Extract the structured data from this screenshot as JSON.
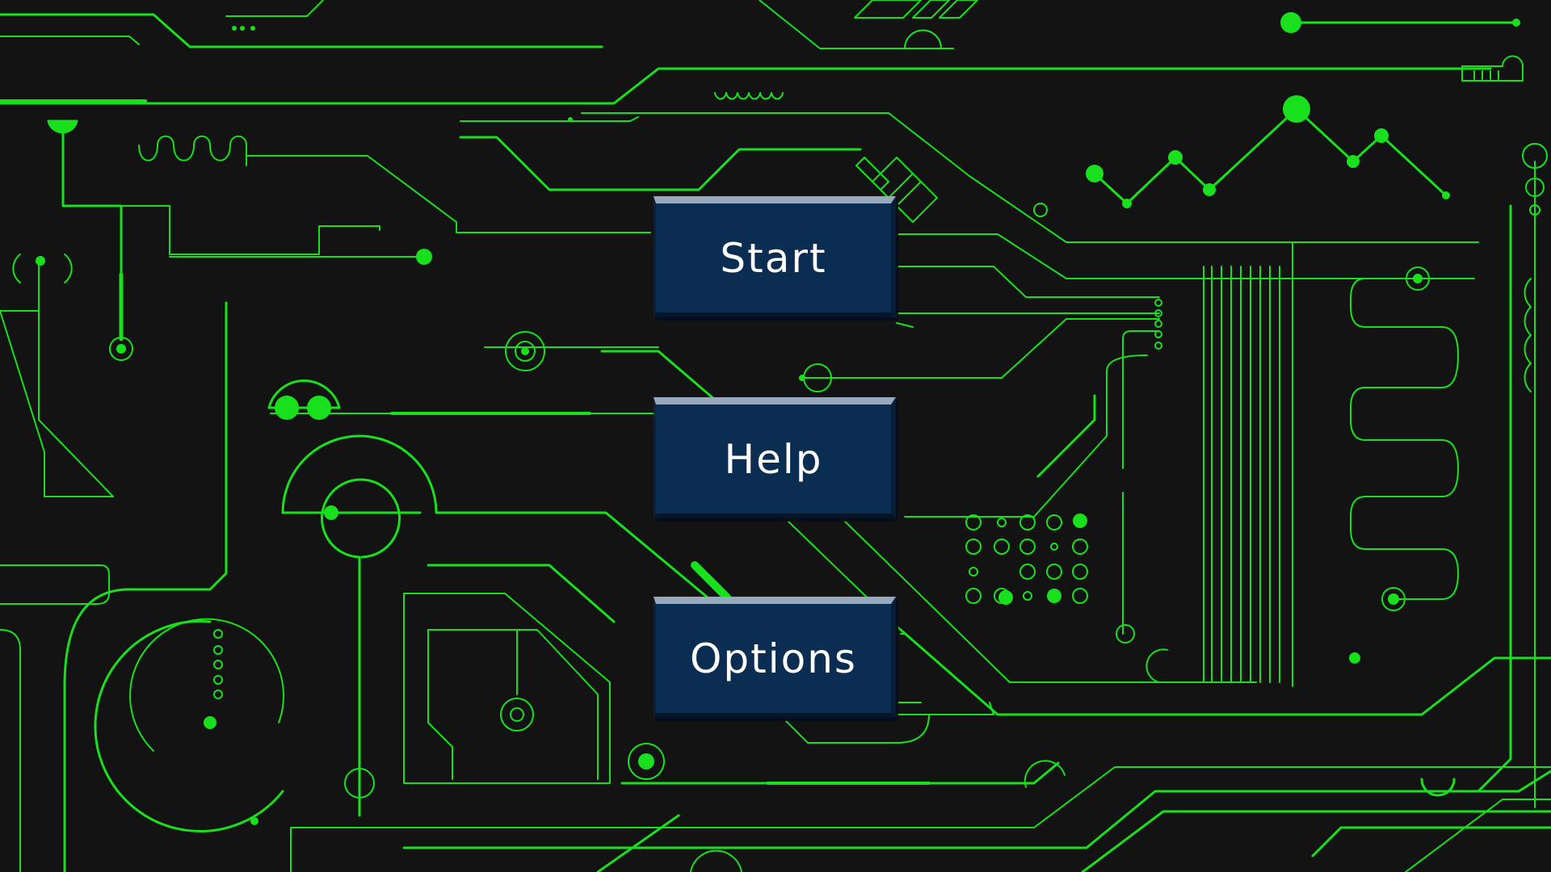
{
  "menu": {
    "start_label": "Start",
    "help_label": "Help",
    "options_label": "Options"
  },
  "background": {
    "theme": "circuit-board",
    "trace_color": "#18e01c",
    "base_color": "#131313"
  },
  "button_style": {
    "fill": "#0c2d52",
    "top_bevel": "#97a9bd",
    "text_color": "#ffffff"
  }
}
